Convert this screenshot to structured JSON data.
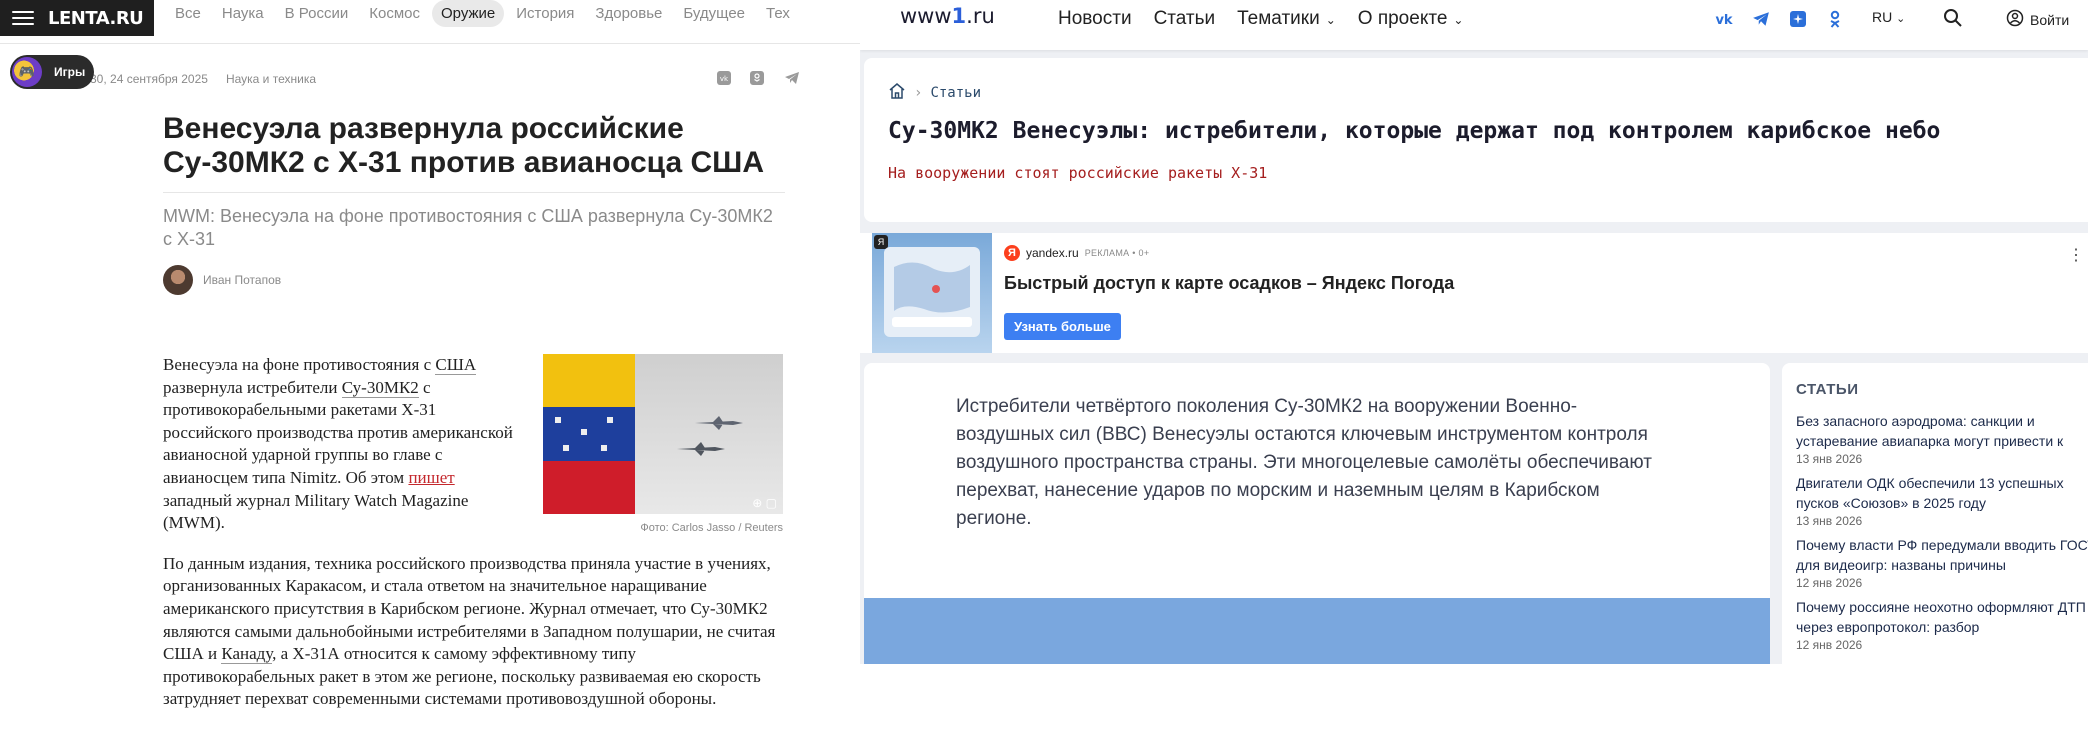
{
  "lenta": {
    "logo": "LENTA.RU",
    "nav": [
      "Все",
      "Наука",
      "В России",
      "Космос",
      "Оружие",
      "История",
      "Здоровье",
      "Будущее",
      "Тех"
    ],
    "nav_active_index": 4,
    "games_label": "Игры",
    "meta_time": "4:30, 24 сентября 2025",
    "meta_rubric": "Наука и техника",
    "share_icons": [
      "vk-icon",
      "odnoklassniki-icon",
      "telegram-icon"
    ],
    "title": "Венесуэла развернула российские Су-30МК2 с Х-31 против авианосца США",
    "lead": "MWM: Венесуэла на фоне противостояния с США развернула Су-30МК2 с Х-31",
    "author": "Иван Потапов",
    "photo_caption": "Фото: Carlos Jasso / Reuters",
    "para1_a": "Венесуэла на фоне противостояния с ",
    "para1_usa": "США",
    "para1_b": " развернула истребители ",
    "para1_su": "Су-30МК2",
    "para1_c": " с противокорабельными ракетами Х-31 российского производства против американской авианосной ударной группы во главе с авианосцем типа Nimitz. Об этом ",
    "para1_link": "пишет",
    "para1_d": " западный журнал Military Watch Magazine (MWM).",
    "para2_a": "По данным издания, техника российского производства приняла участие в учениях, организованных Каракасом, и стала ответом на значительное наращивание американского присутствия в Карибском регионе. Журнал отмечает, что Су-30МК2 являются самыми дальнобойными истребителями в Западном полушарии, не считая США и ",
    "para2_canada": "Канаду",
    "para2_b": ", а Х-31А относится к самому эффективному типу противокорабельных ракет в этом же регионе, поскольку развиваемая ею скорость затрудняет перехват современными системами противовоздушной обороны."
  },
  "www1": {
    "logo_pre": "www",
    "logo_one": "1",
    "logo_post": ".ru",
    "nav": [
      {
        "label": "Новости",
        "dropdown": false
      },
      {
        "label": "Статьи",
        "dropdown": false
      },
      {
        "label": "Тематики",
        "dropdown": true
      },
      {
        "label": "О проекте",
        "dropdown": true
      }
    ],
    "lang": "RU",
    "login": "Войти",
    "breadcrumb": "Статьи",
    "title": "Су-30МК2 Венесуэлы: истребители, которые держат под контролем карибское небо",
    "subtitle": "На вооружении стоят российские ракеты Х-31",
    "ad": {
      "source": "yandex.ru",
      "label": "РЕКЛАМА • 0+",
      "title": "Быстрый доступ к карте осадков – Яндекс Погода",
      "button": "Узнать больше"
    },
    "lead": "Истребители четвёртого поколения Су-30МК2 на вооружении Военно-воздушных сил (ВВС) Венесуэлы остаются ключевым инструментом контроля воздушного пространства страны. Эти многоцелевые самолёты обеспечивают перехват, нанесение ударов по морским и наземным целям в Карибском регионе.",
    "sidebar_heading": "СТАТЬИ",
    "sidebar_items": [
      {
        "title": "Без запасного аэродрома: санкции и устаревание авиапарка могут привести к",
        "date": "13 янв 2026"
      },
      {
        "title": "Двигатели ОДК обеспечили 13 успешных пусков «Союзов» в 2025 году",
        "date": "13 янв 2026"
      },
      {
        "title": "Почему власти РФ передумали вводить ГОСТ для видеоигр: названы причины",
        "date": "12 янв 2026"
      },
      {
        "title": "Почему россияне неохотно оформляют ДТП через европротокол: разбор",
        "date": "12 янв 2026"
      }
    ],
    "accent": "#2b6fd9",
    "subtitle_color": "#a51e1e"
  }
}
